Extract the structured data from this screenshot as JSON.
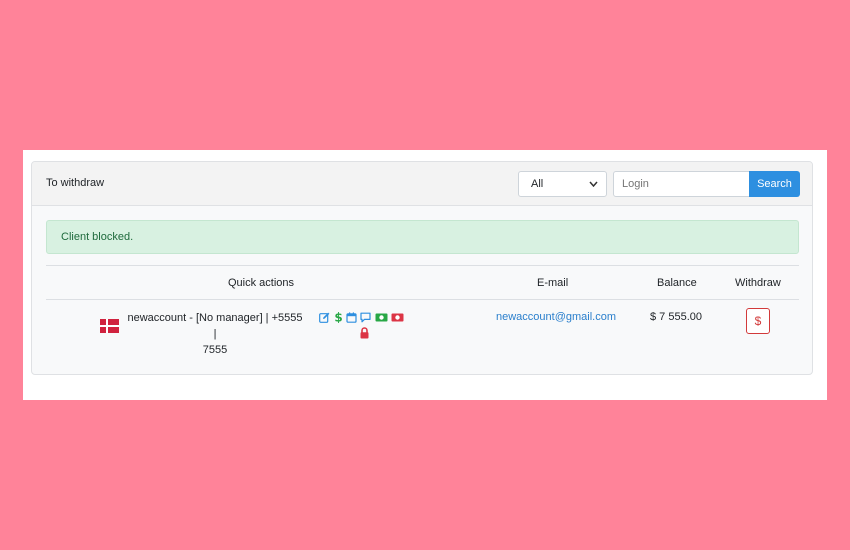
{
  "header": {
    "title": "To withdraw",
    "filter_select_value": "All",
    "login_placeholder": "Login",
    "search_label": "Search"
  },
  "alert": {
    "text": "Client blocked."
  },
  "table": {
    "columns": [
      "Quick actions",
      "E-mail",
      "Balance",
      "Withdraw"
    ],
    "rows": [
      {
        "flag_icon": "denmark-flag-icon",
        "client_line1": "newaccount - [No manager] | +5555 |",
        "client_line2": "7555",
        "quick_action_icons": [
          "edit-icon",
          "dollar-icon",
          "calendar-icon",
          "chat-icon",
          "money-bill-icon",
          "money-minus-icon",
          "lock-icon"
        ],
        "email": "newaccount@gmail.com",
        "balance": "$ 7 555.00",
        "withdraw_label": "$"
      }
    ]
  },
  "colors": {
    "page_background": "#ff8399",
    "primary": "#2d8fe0",
    "success_bg": "#d8f1e1",
    "success_text": "#1e6a3c",
    "danger": "#d23a3a",
    "link": "#2a7fcc",
    "icon_blue": "#2d8fe0",
    "icon_green": "#28a745",
    "icon_red": "#dc3545"
  }
}
